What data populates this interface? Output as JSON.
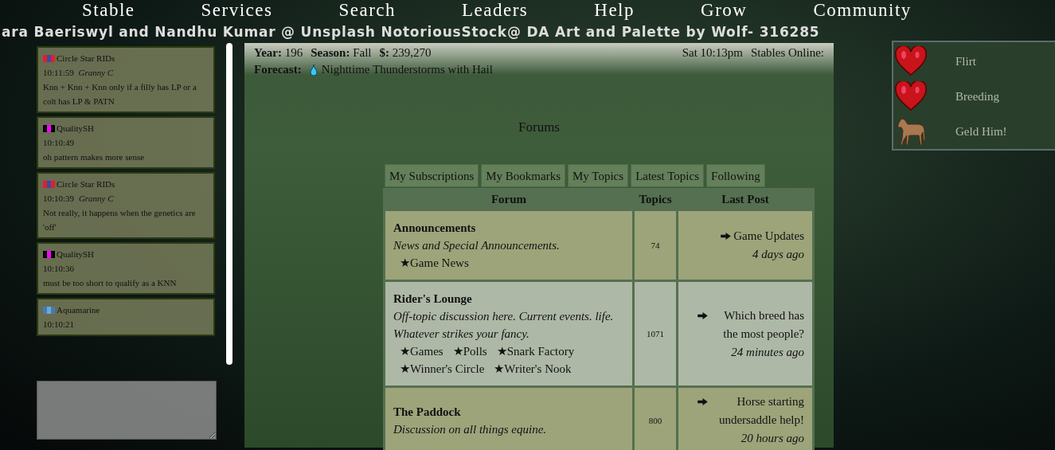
{
  "nav": [
    "Stable",
    "Services",
    "Search",
    "Leaders",
    "Help",
    "Grow",
    "Community"
  ],
  "credits": "ara Baeriswyl and Nandhu Kumar @ Unsplash NotoriousStock@ DA  Art and Palette by Wolf- 316285",
  "chat": [
    {
      "name": "Circle Star RIDs",
      "flag": [
        {
          "color": "#e0202c"
        },
        {
          "color": "#3a4aa8"
        },
        {
          "color": "#e0202c"
        }
      ],
      "time": "10:11:59",
      "user": "Granny C",
      "text": "Knn + Knn + Knn only if a filly has LP or a colt has LP & PATN"
    },
    {
      "name": "QualitySH",
      "flag": [
        {
          "color": "#000000"
        },
        {
          "color": "#ff00ff"
        },
        {
          "color": "#000000"
        }
      ],
      "time": "10:10:49",
      "text": "oh pattern makes more sense"
    },
    {
      "name": "Circle Star RIDs",
      "flag": [
        {
          "color": "#e0202c"
        },
        {
          "color": "#3a4aa8"
        },
        {
          "color": "#e0202c"
        }
      ],
      "time": "10:10:39",
      "user": "Granny C",
      "text": "Not really, it happens when the genetics are 'off'"
    },
    {
      "name": "QualitySH",
      "flag": [
        {
          "color": "#000000"
        },
        {
          "color": "#ff00ff"
        },
        {
          "color": "#000000"
        }
      ],
      "time": "10:10:36",
      "text": "must be too short to qualify as a KNN"
    },
    {
      "name": "Aquamarine",
      "flag": [
        {
          "color": "#4a78b0"
        },
        {
          "color": "#6aaad8"
        },
        {
          "color": "#4a78b0"
        }
      ],
      "time": "10:10:21"
    }
  ],
  "status": {
    "year_label": "Year:",
    "year": "196",
    "season_label": "Season:",
    "season": "Fall",
    "money_label": "$:",
    "money": "239,270",
    "time": "Sat 10:13pm",
    "online_label": "Stables Online:",
    "forecast_label": "Forecast:",
    "forecast": "Nighttime Thunderstorms with Hail"
  },
  "title": "Forums",
  "tabs": [
    "My Subscriptions",
    "My Bookmarks",
    "My Topics",
    "Latest Topics",
    "Following"
  ],
  "table": {
    "columns": [
      "Forum",
      "Topics",
      "Last Post"
    ],
    "rows": [
      {
        "title": "Announcements",
        "description": "News and Special Announcements.",
        "subforums": [
          "★Game News"
        ],
        "topics": "74",
        "last_post": "Game Updates",
        "last_time": "4 days ago",
        "highlighted": false
      },
      {
        "title": "Rider's Lounge",
        "description": "Off-topic discussion here. Current events. life. Whatever strikes your fancy.",
        "subforums": [
          "★Games",
          "★Polls",
          "★Snark Factory",
          "★Winner's Circle",
          "★Writer's Nook"
        ],
        "topics": "1071",
        "last_post": "Which breed has the most people?",
        "last_time": "24 minutes ago",
        "highlighted": true
      },
      {
        "title": "The Paddock",
        "description": "Discussion on all things equine.",
        "subforums": [],
        "topics": "800",
        "last_post": "Horse starting undersaddle help!",
        "last_time": "20 hours ago",
        "highlighted": false
      }
    ]
  },
  "actions": [
    {
      "kind": "heart",
      "label": "Flirt"
    },
    {
      "kind": "heart",
      "label": "Breeding"
    },
    {
      "kind": "horse",
      "label": "Geld Him!"
    }
  ]
}
